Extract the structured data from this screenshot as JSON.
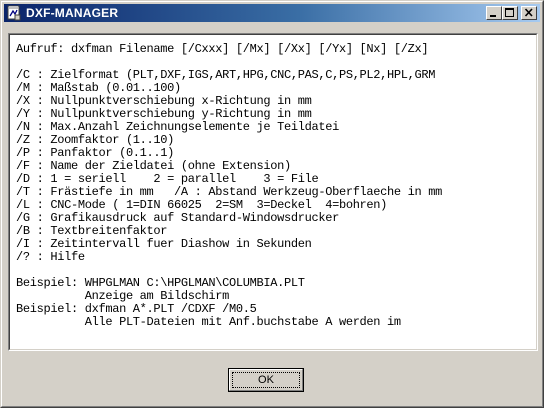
{
  "window": {
    "title": "DXF-MANAGER",
    "icon": "dxf-manager-app-icon",
    "caption_buttons": [
      "minimize-icon",
      "maximize-icon",
      "close-icon"
    ]
  },
  "help": {
    "lines": [
      "Aufruf: dxfman Filename [/Cxxx] [/Mx] [/Xx] [/Yx] [Nx] [/Zx]",
      "",
      "/C : Zielformat (PLT,DXF,IGS,ART,HPG,CNC,PAS,C,PS,PL2,HPL,GRM",
      "/M : Maßstab (0.01..100)",
      "/X : Nullpunktverschiebung x-Richtung in mm",
      "/Y : Nullpunktverschiebung y-Richtung in mm",
      "/N : Max.Anzahl Zeichnungselemente je Teildatei",
      "/Z : Zoomfaktor (1..10)",
      "/P : Panfaktor (0.1..1)",
      "/F : Name der Zieldatei (ohne Extension)",
      "/D : 1 = seriell    2 = parallel    3 = File",
      "/T : Frästiefe in mm   /A : Abstand Werkzeug-Oberflaeche in mm",
      "/L : CNC-Mode ( 1=DIN 66025  2=SM  3=Deckel  4=bohren)",
      "/G : Grafikausdruck auf Standard-Windowsdrucker",
      "/B : Textbreitenfaktor",
      "/I : Zeitintervall fuer Diashow in Sekunden",
      "/? : Hilfe",
      "",
      "Beispiel: WHPGLMAN C:\\HPGLMAN\\COLUMBIA.PLT",
      "          Anzeige am Bildschirm",
      "Beispiel: dxfman A*.PLT /CDXF /M0.5",
      "          Alle PLT-Dateien mit Anf.buchstabe A werden im"
    ]
  },
  "buttons": {
    "ok_label": "OK"
  }
}
